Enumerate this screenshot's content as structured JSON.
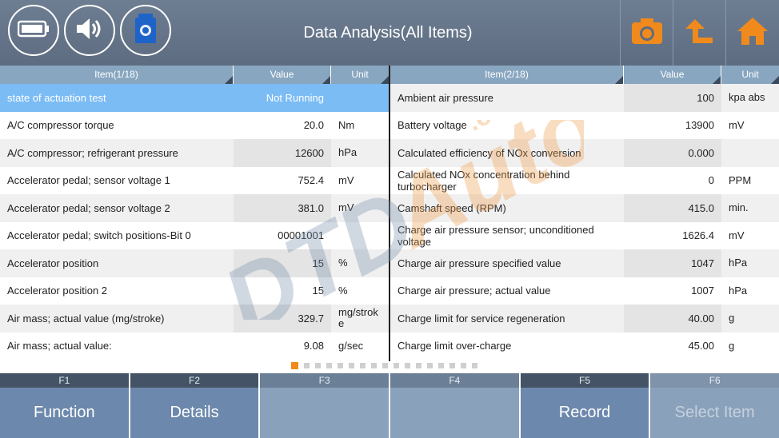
{
  "header": {
    "title": "Data Analysis(All Items)",
    "status_icons": [
      "battery-icon",
      "speaker-icon",
      "vci-device-icon"
    ],
    "buttons": [
      "camera-icon",
      "back-arrow-icon",
      "home-icon"
    ],
    "accent_color": "#f08a1c"
  },
  "left_table": {
    "headers": {
      "item": "Item(1/18)",
      "value": "Value",
      "unit": "Unit"
    },
    "rows": [
      {
        "item": "state of actuation test",
        "value": "Not Running",
        "unit": ""
      },
      {
        "item": "A/C compressor torque",
        "value": "20.0",
        "unit": "Nm"
      },
      {
        "item": "A/C compressor; refrigerant pressure",
        "value": "12600",
        "unit": "hPa"
      },
      {
        "item": "Accelerator pedal; sensor voltage 1",
        "value": "752.4",
        "unit": "mV"
      },
      {
        "item": "Accelerator pedal; sensor voltage 2",
        "value": "381.0",
        "unit": "mV"
      },
      {
        "item": "Accelerator pedal; switch positions-Bit 0",
        "value": "00001001",
        "unit": ""
      },
      {
        "item": "Accelerator position",
        "value": "15",
        "unit": "%"
      },
      {
        "item": "Accelerator position 2",
        "value": "15",
        "unit": "%"
      },
      {
        "item": "Air mass; actual value (mg/stroke)",
        "value": "329.7",
        "unit": "mg/stroke"
      },
      {
        "item": "Air mass; actual value:",
        "value": "9.08",
        "unit": "g/sec"
      }
    ]
  },
  "right_table": {
    "headers": {
      "item": "Item(2/18)",
      "value": "Value",
      "unit": "Unit"
    },
    "rows": [
      {
        "item": "Ambient air pressure",
        "value": "100",
        "unit": "kpa abs"
      },
      {
        "item": "Battery voltage",
        "value": "13900",
        "unit": "mV"
      },
      {
        "item": "Calculated efficiency of NOx conversion",
        "value": "0.000",
        "unit": ""
      },
      {
        "item": "Calculated NOx concentration behind turbocharger",
        "value": "0",
        "unit": "PPM"
      },
      {
        "item": "Camshaft speed (RPM)",
        "value": "415.0",
        "unit": "min."
      },
      {
        "item": "Charge air pressure sensor; unconditioned voltage",
        "value": "1626.4",
        "unit": "mV"
      },
      {
        "item": "Charge air pressure specified value",
        "value": "1047",
        "unit": "hPa"
      },
      {
        "item": "Charge air pressure; actual value",
        "value": "1007",
        "unit": "hPa"
      },
      {
        "item": "Charge limit for service regeneration",
        "value": "40.00",
        "unit": "g"
      },
      {
        "item": "Charge limit over-charge",
        "value": "45.00",
        "unit": "g"
      }
    ]
  },
  "pagination": {
    "pages": 17,
    "current": 1
  },
  "fkeys": [
    {
      "num": "F1",
      "label": "Function"
    },
    {
      "num": "F2",
      "label": "Details"
    },
    {
      "num": "F3",
      "label": ""
    },
    {
      "num": "F4",
      "label": ""
    },
    {
      "num": "F5",
      "label": "Record"
    },
    {
      "num": "F6",
      "label": "Select Item"
    }
  ],
  "watermark": "DTDAuto.com"
}
